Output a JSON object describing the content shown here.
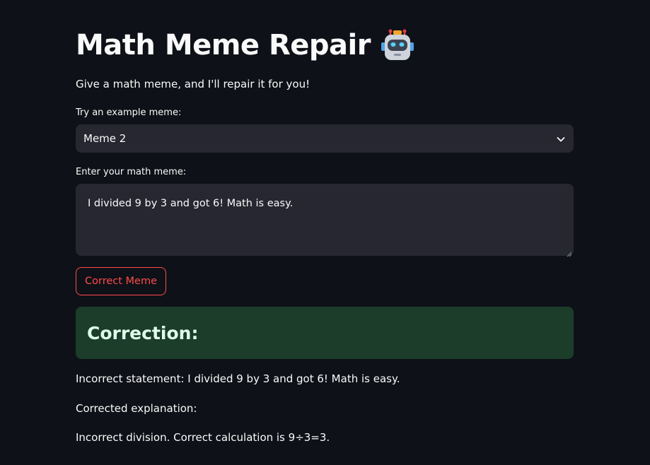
{
  "header": {
    "title": "Math Meme Repair",
    "title_icon": "robot-emoji",
    "subtitle": "Give a math meme, and I'll repair it for you!"
  },
  "example_select": {
    "label": "Try an example meme:",
    "selected": "Meme 2"
  },
  "meme_input": {
    "label": "Enter your math meme:",
    "value": "I divided 9 by 3 and got 6! Math is easy."
  },
  "correct_button": {
    "label": "Correct Meme"
  },
  "result": {
    "heading": "Correction:",
    "incorrect_statement": "Incorrect statement: I divided 9 by 3 and got 6! Math is easy.",
    "explanation_label": "Corrected explanation:",
    "explanation": "Incorrect division. Correct calculation is 9÷3=3."
  },
  "colors": {
    "background": "#0e1117",
    "widget": "#262730",
    "accent": "#ff4b4b",
    "success_bg": "#1b3d2a",
    "success_text": "#dffde9"
  }
}
